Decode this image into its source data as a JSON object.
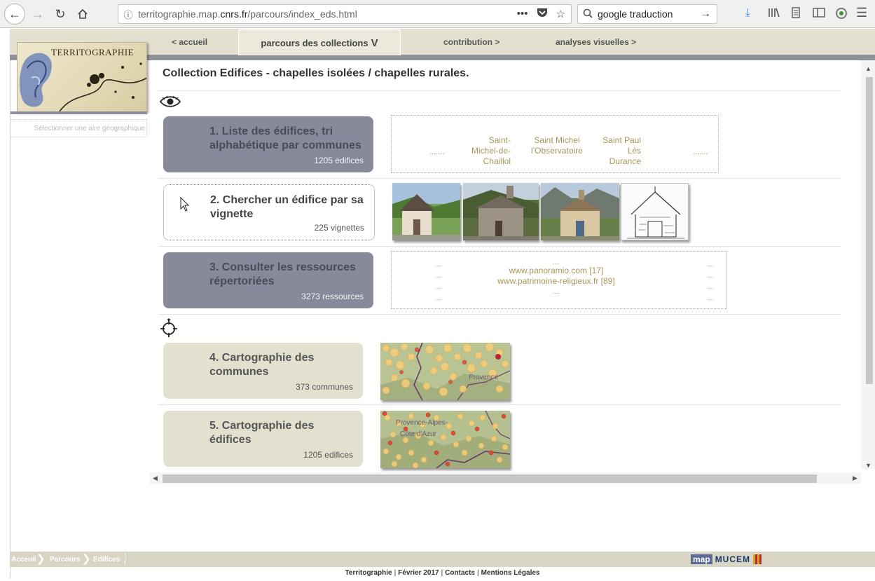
{
  "browser": {
    "url_prefix": "territographie.map.",
    "url_domain": "cnrs.fr",
    "url_path": "/parcours/index_eds.html",
    "search_text": "google traduction"
  },
  "nav": {
    "accueil": "< accueil",
    "parcours": "parcours des collections",
    "parcours_chevron": "V",
    "contribution": "contribution >",
    "analyses": "analyses visuelles >"
  },
  "logo": {
    "text": "TERRITOGRAPHIE"
  },
  "sidebar": {
    "geo_selector": "Sélectionner une aire géographique"
  },
  "heading": "Collection Edifices - chapelles isolées / chapelles rurales.",
  "cards": [
    {
      "title": "1. Liste des édifices, tri alphabétique par communes",
      "count": "1205 edifices"
    },
    {
      "title": "2. Chercher un édifice par sa vignette",
      "count": "225 vignettes"
    },
    {
      "title": "3. Consulter les ressources répertoriées",
      "count": "3273 ressources"
    },
    {
      "title": "4. Cartographie des communes",
      "count": "373 communes"
    },
    {
      "title": "5. Cartographie des édifices",
      "count": "1205 edifices"
    }
  ],
  "list_preview": {
    "dots_left": ".......",
    "item1": "Saint-Michel-de-Chaillol",
    "item2": "Saint Michel l'Observatoire",
    "item3": "Saint Paul Lès Durance",
    "dots_right": "......."
  },
  "resources": {
    "dots": "....",
    "dots_center": "....",
    "link1": "www.panoramio.com [17]",
    "link2": "www.patrimoine-religieux.fr [89]"
  },
  "breadcrumb": [
    "Acceuil",
    "Parcours",
    "Edifices"
  ],
  "footer": {
    "site": "Territographie",
    "date": "Février 2017",
    "contacts": "Contacts",
    "legal": "Mentions Légales",
    "sep": "|",
    "logo_map": "map",
    "logo_mucem": "MUCEM"
  },
  "colors": {
    "nav_band": "#e4e0cf",
    "dark_card": "#878a9b",
    "beige_card": "#e4e0cf",
    "gold_text": "#a79758"
  }
}
